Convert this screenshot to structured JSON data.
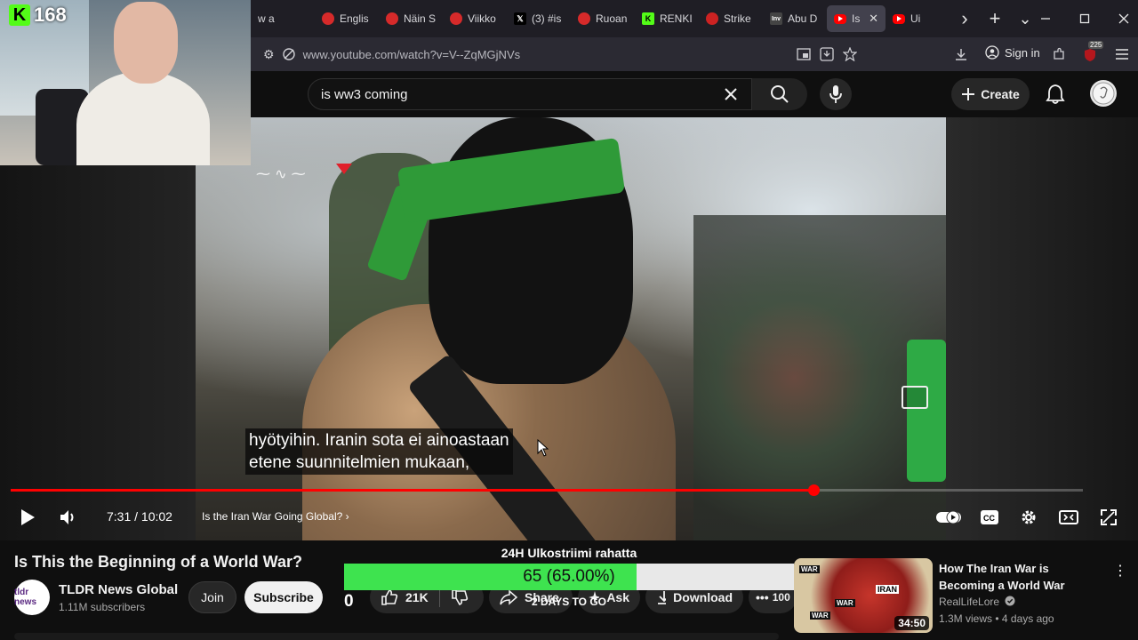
{
  "stream": {
    "kick_icon": "kick-logo-icon",
    "kick_viewers": "168"
  },
  "browser": {
    "tabs": [
      {
        "title": "w a",
        "icon": "none",
        "color": "#1f1e25"
      },
      {
        "title": "Englis",
        "icon": "red-circle",
        "color": "#d62a2a"
      },
      {
        "title": "Näin S",
        "icon": "red-circle",
        "color": "#d62a2a"
      },
      {
        "title": "Viikko",
        "icon": "red-circle",
        "color": "#d62a2a"
      },
      {
        "title": "(3) #is",
        "icon": "x-logo",
        "color": "#000000"
      },
      {
        "title": "Ruoan",
        "icon": "red-circle",
        "color": "#d62a2a"
      },
      {
        "title": "RENKI",
        "icon": "kick-k",
        "color": "#53fc18"
      },
      {
        "title": "Strike",
        "icon": "strike",
        "color": "#cc2222"
      },
      {
        "title": "Abu D",
        "icon": "inv",
        "color": "#444444"
      },
      {
        "title": "Is T",
        "icon": "youtube",
        "color": "#ff0000",
        "active": true
      },
      {
        "title": "Ui",
        "icon": "youtube",
        "color": "#ff0000"
      }
    ],
    "url": "www.youtube.com/watch?v=V--ZqMGjNVs",
    "sign_in": "Sign in",
    "badge_count": "225"
  },
  "masthead": {
    "search_value": "is ww3 coming",
    "create_label": "Create"
  },
  "player": {
    "subtitle_line1": "hyötyihin.  Iranin sota ei ainoastaan",
    "subtitle_line2": "etene suunnitelmien mukaan,",
    "time": "7:31 / 10:02",
    "chapter": "Is the Iran War Going Global?",
    "progress_fraction": 0.7487,
    "buffered_fraction": 0.81
  },
  "video": {
    "title": "Is This the Beginning of a World War?",
    "channel_avatar_text": "tldr news",
    "channel_name": "TLDR News Global",
    "subscribers": "1.11M subscribers",
    "join_label": "Join",
    "subscribe_label": "Subscribe",
    "likes": "21K",
    "share_label": "Share",
    "ask_label": "Ask",
    "download_label": "Download",
    "more_count": "100"
  },
  "donation_goal": {
    "title": "24H Ulkostriimi rahatta",
    "label": "65 (65.00%)",
    "fraction": 0.65,
    "left_value": "0",
    "time_left": "2 DAYS TO GO"
  },
  "recommendation": {
    "title": "How The Iran War is Becoming a World War",
    "channel": "RealLifeLore",
    "meta": "1.3M views • 4 days ago",
    "duration": "34:50",
    "thumb_iran": "IRAN",
    "thumb_war": "WAR"
  }
}
